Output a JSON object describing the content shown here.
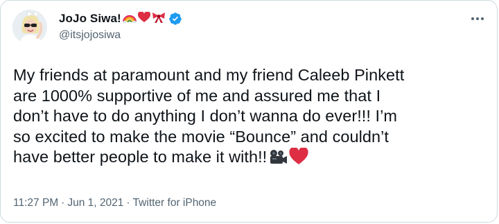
{
  "tweet": {
    "display_name": "JoJo Siwa!",
    "handle": "@itsjojosiwa",
    "emojis": [
      "rainbow-emoji",
      "red-heart-emoji",
      "ribbon-emoji"
    ],
    "verified": true,
    "body_lines": [
      "My friends at paramount and my friend Caleeb Pinkett",
      "are 1000% supportive of me and assured me that I",
      "don’t have to do anything I don’t wanna do ever!!! I’m",
      "so excited to make the movie “Bounce” and couldn’t",
      "have better people to make it with!!"
    ],
    "body_trailing_emojis": [
      "movie-camera-emoji",
      "red-heart-emoji"
    ],
    "time": "11:27 PM",
    "date": "Jun 1, 2021",
    "source": "Twitter for iPhone",
    "separator": "·"
  },
  "colors": {
    "text": "#0f1419",
    "secondary": "#536471",
    "verified_blue": "#1d9bf0",
    "border": "#cfd9de",
    "heart_red": "#e0245e"
  }
}
